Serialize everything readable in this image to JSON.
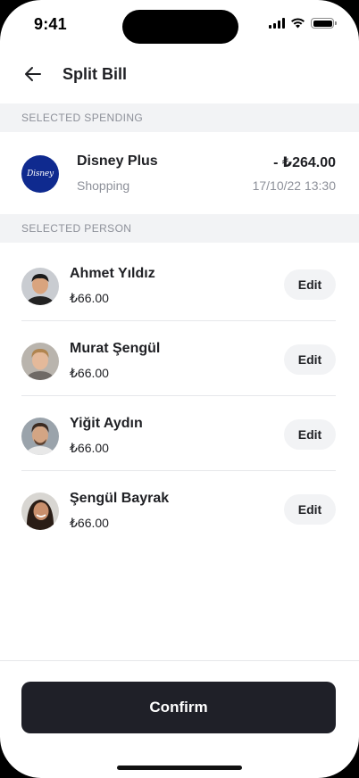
{
  "status_bar": {
    "time": "9:41"
  },
  "header": {
    "title": "Split Bill"
  },
  "sections": {
    "spending_title": "SELECTED SPENDING",
    "person_title": "SELECTED PERSON"
  },
  "spending": {
    "logo_text": "Disney",
    "name": "Disney Plus",
    "category": "Shopping",
    "amount": "- ₺264.00",
    "date": "17/10/22 13:30"
  },
  "persons": [
    {
      "name": "Ahmet Yıldız",
      "amount": "₺66.00",
      "edit_label": "Edit"
    },
    {
      "name": "Murat Şengül",
      "amount": "₺66.00",
      "edit_label": "Edit"
    },
    {
      "name": "Yiğit Aydın",
      "amount": "₺66.00",
      "edit_label": "Edit"
    },
    {
      "name": "Şengül Bayrak",
      "amount": "₺66.00",
      "edit_label": "Edit"
    }
  ],
  "footer": {
    "confirm_label": "Confirm"
  },
  "colors": {
    "primary_button": "#1f2028",
    "section_bg": "#f2f3f5",
    "disney_blue": "#0f2a8f",
    "muted_text": "#8d9099"
  },
  "icons": {
    "back": "arrow-left-icon",
    "signal": "cellular-signal-icon",
    "wifi": "wifi-icon",
    "battery": "battery-icon"
  }
}
